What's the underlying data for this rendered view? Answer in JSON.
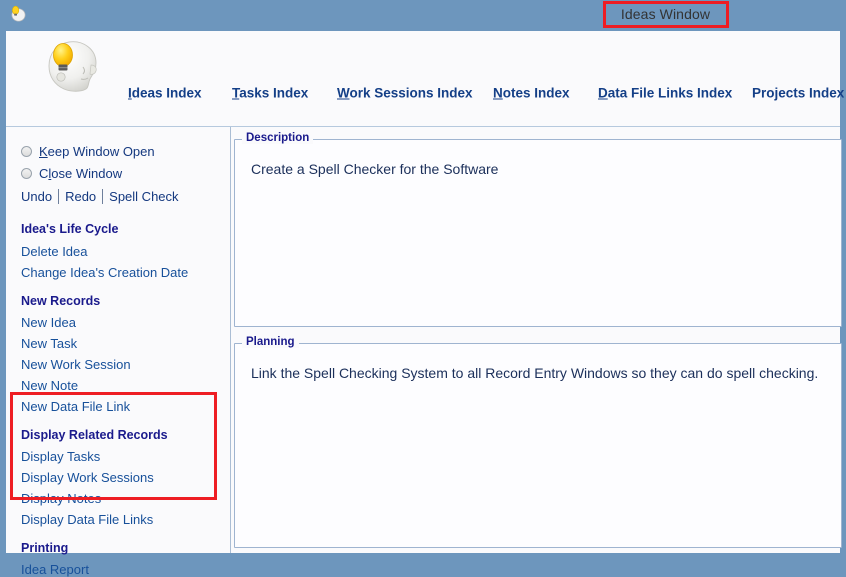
{
  "window": {
    "title": "Ideas Window",
    "titlebar_icon": "lightbulb-head-icon",
    "accent_blue": "#6d96bd",
    "annotation_color": "#ee1d23"
  },
  "header": {
    "logo_icon": "lightbulb-head-logo",
    "nav": [
      {
        "label": "Ideas Index",
        "accel": "I",
        "underlined": true
      },
      {
        "label": "Tasks Index",
        "accel": "T",
        "underlined": true
      },
      {
        "label": "Work Sessions Index",
        "accel": "W",
        "underlined": true
      },
      {
        "label": "Notes Index",
        "accel": "N",
        "underlined": true
      },
      {
        "label": "Data File Links Index",
        "accel": "D",
        "underlined": true
      },
      {
        "label": "Projects Index",
        "accel": "",
        "underlined": false
      }
    ]
  },
  "sidebar": {
    "radios": [
      {
        "label_pre": "",
        "label_accel": "K",
        "label_post": "eep Window Open",
        "selected": false
      },
      {
        "label_pre": "C",
        "label_accel": "l",
        "label_post": "ose Window",
        "selected": false
      }
    ],
    "tools": [
      "Undo",
      "Redo",
      "Spell Check"
    ],
    "groups": [
      {
        "title": "Idea's Life Cycle",
        "items": [
          "Delete Idea",
          "Change Idea's Creation Date"
        ]
      },
      {
        "title": "New Records",
        "items": [
          "New Idea",
          "New Task",
          "New Work Session",
          "New Note",
          "New Data File Link"
        ]
      },
      {
        "title": "Display Related Records",
        "items": [
          "Display Tasks",
          "Display Work Sessions",
          "Display Notes",
          "Display Data File Links"
        ]
      },
      {
        "title": "Printing",
        "items": [
          "Idea Report"
        ]
      }
    ]
  },
  "content": {
    "description": {
      "legend": "Description",
      "text": "Create a Spell Checker for the Software"
    },
    "planning": {
      "legend": "Planning",
      "text": "Link the Spell Checking System to all Record Entry Windows so they can do spell checking."
    }
  }
}
